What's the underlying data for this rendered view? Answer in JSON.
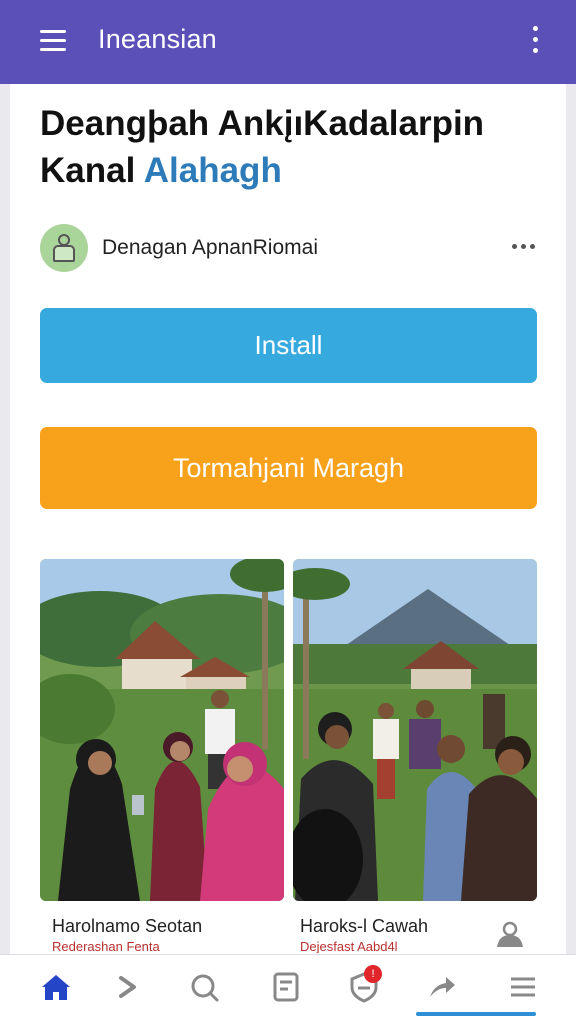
{
  "appbar": {
    "title": "Ineansian",
    "menu_icon": "menu-icon",
    "overflow_icon": "more-vert-icon"
  },
  "article": {
    "title_main": "Deangþah AnkįıKadalarpin Kanal",
    "title_accent": "Alahagh"
  },
  "author": {
    "name": "Denagan ApnanRiomai",
    "avatar_icon": "user-avatar-icon",
    "more_icon": "more-horiz-icon"
  },
  "actions": {
    "install_label": "Install",
    "secondary_label": "Tormahjani Maragh"
  },
  "gallery": [
    {
      "caption": "Harolnamo Seotan",
      "subcaption": "Rederashan Fenta"
    },
    {
      "caption": "Haroks-l Cawah",
      "subcaption": "Dejesfast Aabd4l"
    }
  ],
  "bottom_nav": {
    "items": [
      {
        "icon": "home-icon",
        "active": true
      },
      {
        "icon": "chevron-right-icon"
      },
      {
        "icon": "search-icon"
      },
      {
        "icon": "document-icon"
      },
      {
        "icon": "shield-icon",
        "badge": "!"
      },
      {
        "icon": "share-icon"
      },
      {
        "icon": "list-menu-icon"
      }
    ]
  },
  "colors": {
    "appbar": "#5b50b8",
    "install_button": "#36a9df",
    "secondary_button": "#f8a11b",
    "accent_text": "#2d7bb8",
    "nav_active": "#2446c6",
    "badge": "#e0262b"
  }
}
